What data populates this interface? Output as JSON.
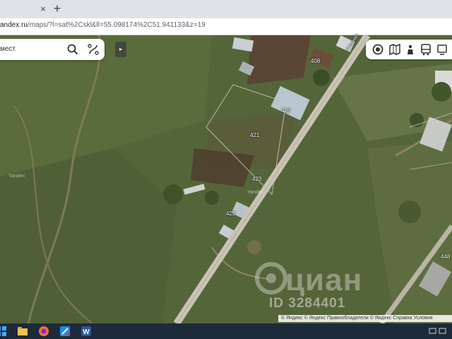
{
  "browser": {
    "tab_close": "×",
    "tab_new": "+",
    "url_domain": "andex.ru",
    "url_path": "/maps/?l=sat%2Cskl&ll=55.098174%2C51.941133&z=19"
  },
  "search": {
    "placeholder": "мест",
    "collapse_label": "▸"
  },
  "map": {
    "road_label": "Степная",
    "house_labels": [
      "408",
      "419",
      "421",
      "423",
      "425",
      "448"
    ],
    "provider_marks": [
      "Yandex",
      "Yandex"
    ]
  },
  "watermark": {
    "brand": "циан",
    "listing_id": "ID 3284401"
  },
  "copyright": "© Яндекс © Яндекс  Правообладатели  © Яндекс  Справка  Условия",
  "colors": {
    "accent": "#ffffff",
    "road": "#c9c4b4",
    "field": "#56663a"
  },
  "icons": {
    "search": "search-icon",
    "route": "route-icon",
    "layers": [
      "layers-icon",
      "map-icon",
      "panorama-icon",
      "transit-icon",
      "more-icon"
    ],
    "taskbar": [
      "windows-icon",
      "file-explorer-icon",
      "firefox-icon",
      "app-icon",
      "word-icon"
    ]
  }
}
